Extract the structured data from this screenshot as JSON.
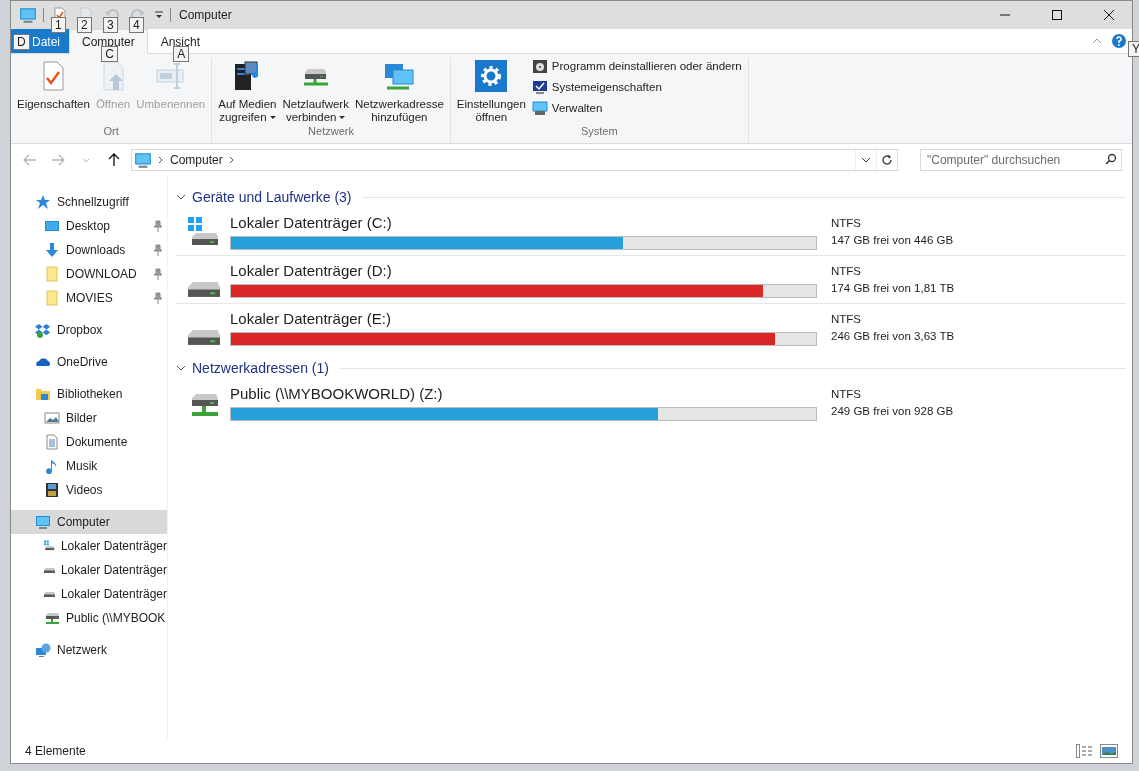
{
  "window": {
    "title": "Computer"
  },
  "quick_access": [
    {
      "kind": "properties",
      "key_tip": "1",
      "disabled": false
    },
    {
      "kind": "new-folder",
      "key_tip": "2",
      "disabled": true
    },
    {
      "kind": "undo",
      "key_tip": "3",
      "disabled": true
    },
    {
      "kind": "redo",
      "key_tip": "4",
      "disabled": true
    }
  ],
  "ribbon": {
    "tabs": [
      {
        "label": "Datei",
        "kind": "file",
        "key_tip": "D",
        "selected": false
      },
      {
        "label": "Computer",
        "kind": "tab",
        "key_tip": "C",
        "selected": true
      },
      {
        "label": "Ansicht",
        "kind": "tab",
        "key_tip": "A",
        "selected": false
      }
    ],
    "help_key_tip": "Y",
    "groups": [
      {
        "label": "Ort",
        "buttons": [
          {
            "lines": [
              "Eigenschaften"
            ],
            "kind": "properties",
            "disabled": false,
            "dropdown": false
          },
          {
            "lines": [
              "Öffnen"
            ],
            "kind": "open",
            "disabled": true,
            "dropdown": false
          },
          {
            "lines": [
              "Umbenennen"
            ],
            "kind": "rename",
            "disabled": true,
            "dropdown": false
          }
        ]
      },
      {
        "label": "Netzwerk",
        "buttons": [
          {
            "lines": [
              "Auf Medien",
              "zugreifen"
            ],
            "kind": "media",
            "disabled": false,
            "dropdown": true
          },
          {
            "lines": [
              "Netzlaufwerk",
              "verbinden"
            ],
            "kind": "map-drive",
            "disabled": false,
            "dropdown": true
          },
          {
            "lines": [
              "Netzwerkadresse",
              "hinzufügen"
            ],
            "kind": "network-location",
            "disabled": false,
            "dropdown": false
          }
        ]
      },
      {
        "label": "System",
        "buttons": [
          {
            "lines": [
              "Einstellungen",
              "öffnen"
            ],
            "kind": "settings",
            "disabled": false,
            "dropdown": false
          }
        ],
        "small_buttons": [
          {
            "label": "Programm deinstallieren oder ändern",
            "kind": "uninstall"
          },
          {
            "label": "Systemeigenschaften",
            "kind": "system-properties"
          },
          {
            "label": "Verwalten",
            "kind": "manage"
          }
        ]
      }
    ]
  },
  "nav_buttons": [
    {
      "kind": "back",
      "disabled": true
    },
    {
      "kind": "forward",
      "disabled": true
    },
    {
      "kind": "recent",
      "disabled": true
    },
    {
      "kind": "up",
      "disabled": false
    }
  ],
  "address": {
    "path": [
      "Computer"
    ]
  },
  "search": {
    "placeholder": "\"Computer\" durchsuchen"
  },
  "sidebar": {
    "items": [
      {
        "label": "Schnellzugriff",
        "kind": "star",
        "selected": false,
        "children": [
          {
            "label": "Desktop",
            "kind": "desktop",
            "pinned": true,
            "selected": false
          },
          {
            "label": "Downloads",
            "kind": "download",
            "pinned": true,
            "selected": false
          },
          {
            "label": "DOWNLOAD",
            "kind": "folder",
            "pinned": true,
            "selected": false
          },
          {
            "label": "MOVIES",
            "kind": "folder",
            "pinned": true,
            "selected": false
          }
        ]
      },
      {
        "label": "Dropbox",
        "kind": "dropbox",
        "selected": false
      },
      {
        "label": "OneDrive",
        "kind": "cloud",
        "selected": false
      },
      {
        "label": "Bibliotheken",
        "kind": "library",
        "selected": false,
        "children": [
          {
            "label": "Bilder",
            "kind": "pictures",
            "pinned": false,
            "selected": false
          },
          {
            "label": "Dokumente",
            "kind": "documents",
            "pinned": false,
            "selected": false
          },
          {
            "label": "Musik",
            "kind": "music",
            "pinned": false,
            "selected": false
          },
          {
            "label": "Videos",
            "kind": "videos",
            "pinned": false,
            "selected": false
          }
        ]
      },
      {
        "label": "Computer",
        "kind": "computer",
        "selected": true,
        "children": [
          {
            "label": "Lokaler Datenträger",
            "kind": "system-drive",
            "pinned": false,
            "selected": false
          },
          {
            "label": "Lokaler Datenträger",
            "kind": "drive",
            "pinned": false,
            "selected": false
          },
          {
            "label": "Lokaler Datenträger",
            "kind": "drive",
            "pinned": false,
            "selected": false
          },
          {
            "label": "Public (\\\\MYBOOK",
            "kind": "network-drive",
            "pinned": false,
            "selected": false
          }
        ]
      },
      {
        "label": "Netzwerk",
        "kind": "network",
        "selected": false
      }
    ]
  },
  "sections": [
    {
      "title": "Geräte und Laufwerke (3)",
      "expanded": true,
      "drives": [
        {
          "name": "Lokaler Datenträger (C:)",
          "kind": "system-drive",
          "level": 0.67,
          "color": "#26a0da",
          "filesystem": "NTFS",
          "free": "147 GB frei von 446 GB"
        },
        {
          "name": "Lokaler Datenträger (D:)",
          "kind": "drive",
          "level": 0.91,
          "color": "#da2626",
          "filesystem": "NTFS",
          "free": "174 GB frei von 1,81 TB"
        },
        {
          "name": "Lokaler Datenträger (E:)",
          "kind": "drive",
          "level": 0.93,
          "color": "#da2626",
          "filesystem": "NTFS",
          "free": "246 GB frei von 3,63 TB"
        }
      ]
    },
    {
      "title": "Netzwerkadressen (1)",
      "expanded": true,
      "drives": [
        {
          "name": "Public (\\\\MYBOOKWORLD) (Z:)",
          "kind": "network-drive",
          "level": 0.73,
          "color": "#26a0da",
          "filesystem": "NTFS",
          "free": "249 GB frei von 928 GB"
        }
      ]
    }
  ],
  "status_bar": {
    "count": "4 Elemente",
    "views": [
      {
        "kind": "details"
      },
      {
        "kind": "tiles"
      }
    ]
  }
}
